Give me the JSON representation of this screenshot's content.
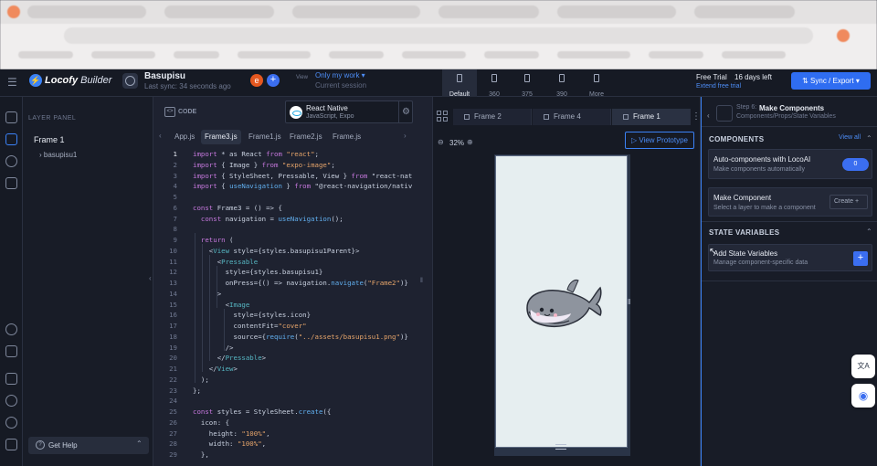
{
  "app": {
    "logo_text": "Locofy",
    "logo_suffix": "Builder",
    "project_name": "Basupisu",
    "last_sync": "Last sync: 34 seconds ago",
    "avatar_initial": "e",
    "view_label": "View",
    "view_filter": "Only my work",
    "view_session": "Current session",
    "devices": [
      {
        "label": "Default",
        "active": true
      },
      {
        "label": "360"
      },
      {
        "label": "375"
      },
      {
        "label": "390"
      },
      {
        "label": "More"
      }
    ],
    "trial_label": "Free Trial",
    "trial_days": "16 days left",
    "extend_link": "Extend free trial",
    "sync_button": "Sync / Export"
  },
  "layers": {
    "header": "LAYER PANEL",
    "frame": "Frame 1",
    "child": "basupisu1",
    "help": "Get Help"
  },
  "code": {
    "header": "CODE",
    "framework": "React Native",
    "framework_sub": "JavaScript, Expo",
    "files": [
      "App.js",
      "Frame3.js",
      "Frame1.js",
      "Frame2.js",
      "Frame.js"
    ],
    "active_file": "Frame3.js",
    "current_line": 1,
    "lines": [
      "import * as React from \"react\";",
      "import { Image } from \"expo-image\";",
      "import { StyleSheet, Pressable, View } from \"react-nat",
      "import { useNavigation } from \"@react-navigation/nativ",
      "",
      "const Frame3 = () => {",
      "  const navigation = useNavigation();",
      "",
      "  return (",
      "    <View style={styles.basupisu1Parent}>",
      "      <Pressable",
      "        style={styles.basupisu1}",
      "        onPress={() => navigation.navigate(\"Frame2\")}",
      "      >",
      "        <Image",
      "          style={styles.icon}",
      "          contentFit=\"cover\"",
      "          source={require(\"../assets/basupisu1.png\")}",
      "        />",
      "      </Pressable>",
      "    </View>",
      "  );",
      "};",
      "",
      "const styles = StyleSheet.create({",
      "  icon: {",
      "    height: \"100%\",",
      "    width: \"100%\",",
      "  },"
    ]
  },
  "canvas": {
    "tabs": [
      "Frame 2",
      "Frame 4",
      "Frame 1"
    ],
    "active_tab": "Frame 1",
    "zoom": "32%",
    "prototype_button": "View Prototype"
  },
  "right": {
    "step_label": "Step 6:",
    "step_title": "Make Components",
    "step_sub": "Components/Props/State Variables",
    "components_header": "COMPONENTS",
    "view_all": "View all",
    "auto_title": "Auto-components with LocoAI",
    "auto_sub": "Make components automatically",
    "auto_count": "0",
    "make_title": "Make Component",
    "make_sub": "Select a layer to make a component",
    "create_button": "Create",
    "state_header": "STATE VARIABLES",
    "add_state_title": "Add State Variables",
    "add_state_sub": "Manage component-specific data"
  },
  "colors": {
    "accent": "#3b82f6",
    "background": "#1b1f2b",
    "phone": "#e6eef0"
  }
}
